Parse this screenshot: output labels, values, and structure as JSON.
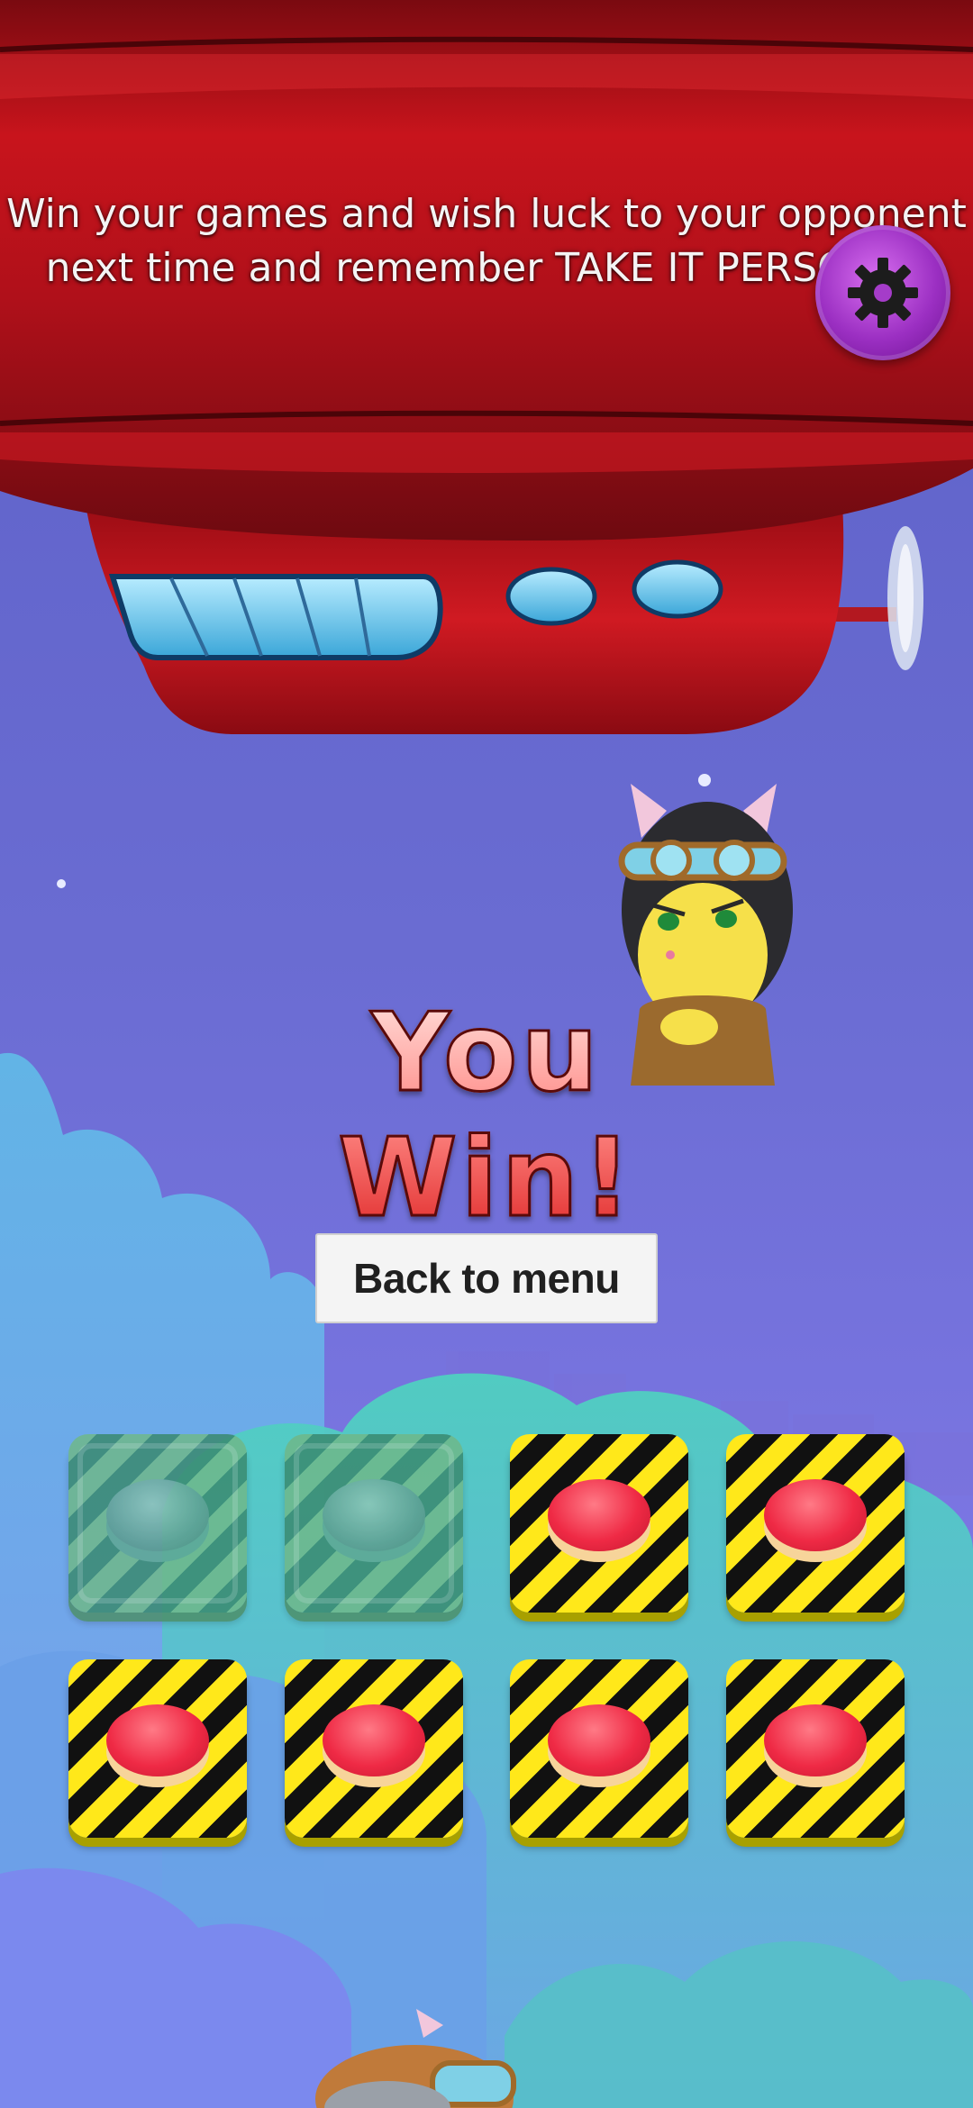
{
  "banner": {
    "line1": "Win your games and wish luck to your opponent",
    "line2": "next time and remember TAKE IT PERSONAL"
  },
  "settings_icon": "gear-icon",
  "result": {
    "title": "You Win!"
  },
  "menu": {
    "back_label": "Back to menu"
  },
  "pads": [
    {
      "state": "pressed"
    },
    {
      "state": "pressed"
    },
    {
      "state": "active"
    },
    {
      "state": "active"
    },
    {
      "state": "active"
    },
    {
      "state": "active"
    },
    {
      "state": "active"
    },
    {
      "state": "active"
    }
  ],
  "colors": {
    "sky_top": "#5a5fc4",
    "sky_bottom": "#8a7cf0",
    "blimp_red": "#c0101a",
    "hazard_yellow": "#ffe81a",
    "button_red": "#ef2a45",
    "settings_purple": "#9b2fc2"
  }
}
